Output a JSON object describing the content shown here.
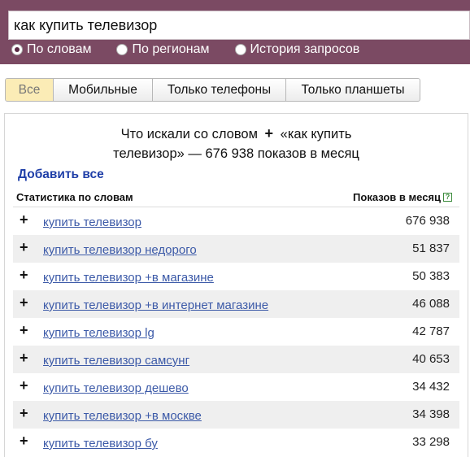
{
  "search": {
    "query": "как купить телевизор"
  },
  "radios": [
    {
      "label": "По словам",
      "selected": true
    },
    {
      "label": "По регионам",
      "selected": false
    },
    {
      "label": "История запросов",
      "selected": false
    }
  ],
  "tabs": [
    {
      "label": "Все",
      "active": true
    },
    {
      "label": "Мобильные",
      "active": false
    },
    {
      "label": "Только телефоны",
      "active": false
    },
    {
      "label": "Только планшеты",
      "active": false
    }
  ],
  "results": {
    "headline_pre": "Что искали со словом",
    "headline_plus": "+",
    "headline_query": "«как купить",
    "headline_line2": "телевизор» — 676 938 показов в месяц",
    "add_all": "Добавить все",
    "col_stats": "Статистика по словам",
    "col_shows": "Показов в месяц",
    "help_icon": "?",
    "add_symbol": "+",
    "rows": [
      {
        "phrase": "купить телевизор",
        "count": "676 938"
      },
      {
        "phrase": "купить телевизор недорого",
        "count": "51 837"
      },
      {
        "phrase": "купить телевизор +в магазине",
        "count": "50 383"
      },
      {
        "phrase": "купить телевизор +в интернет магазине",
        "count": "46 088"
      },
      {
        "phrase": "купить телевизор lg",
        "count": "42 787"
      },
      {
        "phrase": "купить телевизор самсунг",
        "count": "40 653"
      },
      {
        "phrase": "купить телевизор дешево",
        "count": "34 432"
      },
      {
        "phrase": "купить телевизор +в москве",
        "count": "34 398"
      },
      {
        "phrase": "купить телевизор бу",
        "count": "33 298"
      }
    ]
  },
  "colors": {
    "header_bg": "#7b4a63",
    "active_tab": "#fbecb6",
    "link": "#3c5aa8",
    "add_all_link": "#1f3fa8",
    "row_alt": "#efefef"
  }
}
